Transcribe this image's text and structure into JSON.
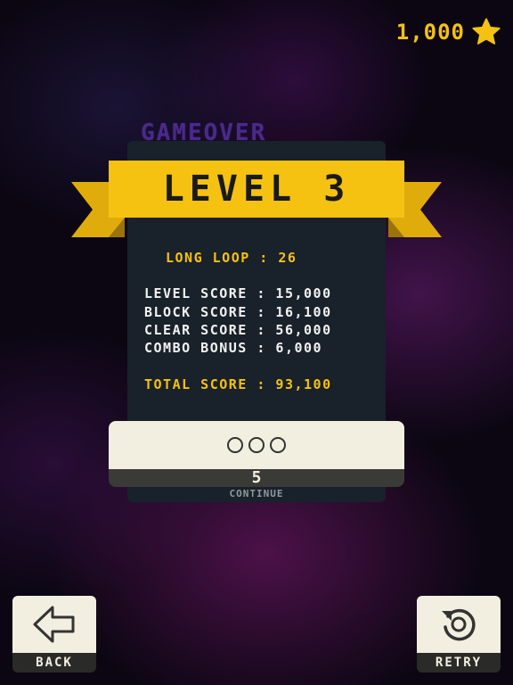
{
  "hud": {
    "coins": "1,000",
    "coin_icon": "star-icon"
  },
  "gameover": {
    "title": "GAMEOVER"
  },
  "level": {
    "label": "LEVEL 3"
  },
  "stats": {
    "long_loop": "LONG LOOP : 26",
    "level_score": "LEVEL SCORE : 15,000",
    "block_score": "BLOCK SCORE : 16,100",
    "clear_score": "CLEAR SCORE : 56,000",
    "combo_bonus": "COMBO BONUS : 6,000",
    "total_score": "TOTAL SCORE : 93,100"
  },
  "continue": {
    "countdown": "5",
    "label": "CONTINUE"
  },
  "buttons": {
    "back": {
      "label": "BACK",
      "icon": "arrow-left-icon"
    },
    "retry": {
      "label": "RETRY",
      "icon": "retry-icon"
    }
  },
  "colors": {
    "accent": "#f5c211",
    "panel": "#19212a",
    "cream": "#f2efe0",
    "title_purple": "#4a2a8a"
  }
}
